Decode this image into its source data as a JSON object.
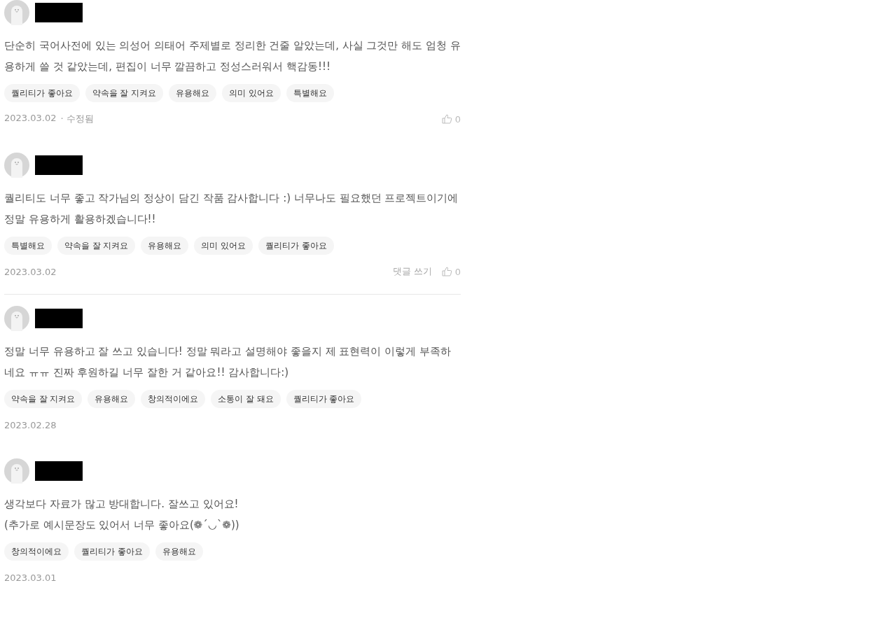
{
  "reviews": [
    {
      "text": "단순히 국어사전에 있는 의성어 의태어 주제별로 정리한 건줄 알았는데,  사실 그것만 해도 엄청 유용하게 쓸 것 같았는데, 편집이 너무 깔끔하고 정성스러워서 핵감동!!!",
      "tags": [
        "퀄리티가 좋아요",
        "약속을 잘 지켜요",
        "유용해요",
        "의미 있어요",
        "특별해요"
      ],
      "date": "2023.03.02",
      "edited": "· 수정됨",
      "likes": "0",
      "divider_below": false
    },
    {
      "text": "퀄리티도 너무 좋고 작가님의 정상이 담긴 작품 감사합니다 :) 너무나도 필요했던 프로젝트이기에 정말 유용하게 활용하겠습니다!!",
      "tags": [
        "특별해요",
        "약속을 잘 지켜요",
        "유용해요",
        "의미 있어요",
        "퀄리티가 좋아요"
      ],
      "date": "2023.03.02",
      "reply": "댓글 쓰기",
      "likes": "0",
      "divider_below": true
    },
    {
      "text": "정말 너무 유용하고 잘 쓰고 있습니다! 정말 뭐라고 설명해야 좋을지 제 표현력이 이렇게 부족하네요 ㅠㅠ 진짜 후원하길 너무 잘한 거 같아요!! 감사합니다:)",
      "tags": [
        "약속을 잘 지켜요",
        "유용해요",
        "창의적이에요",
        "소통이 잘 돼요",
        "퀄리티가 좋아요"
      ],
      "date": "2023.02.28",
      "divider_below": false
    },
    {
      "text": "생각보다 자료가 많고 방대합니다. 잘쓰고 있어요!\n(추가로 예시문장도 있어서 너무 좋아요(❁´◡`❁))",
      "tags": [
        "창의적이에요",
        "퀄리티가 좋아요",
        "유용해요"
      ],
      "date": "2023.03.01",
      "divider_below": false
    }
  ]
}
